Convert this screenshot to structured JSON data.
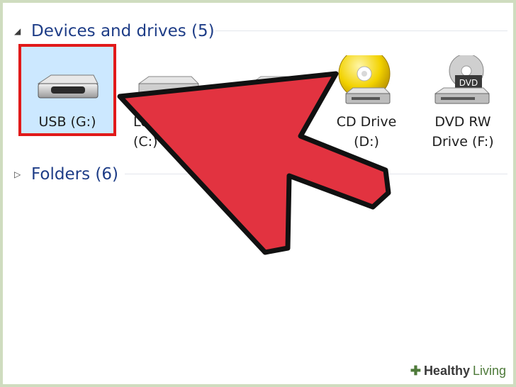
{
  "devices_section": {
    "title": "Devices and drives (5)",
    "expanded": true,
    "items": [
      {
        "label": "USB (G:)",
        "icon": "usb-drive-icon",
        "selected": true
      },
      {
        "label": "Local Disk\n(C:)",
        "icon": "hard-drive-icon",
        "selected": false
      },
      {
        "label": "",
        "icon": "hard-drive-icon",
        "selected": false
      },
      {
        "label": "CD Drive\n(D:)",
        "icon": "cd-drive-icon",
        "selected": false
      },
      {
        "label": "DVD RW\nDrive (F:)",
        "icon": "dvd-drive-icon",
        "selected": false
      }
    ]
  },
  "folders_section": {
    "title": "Folders (6)",
    "expanded": false
  },
  "dvd_badge": "DVD",
  "watermark": {
    "brand": "Healthy",
    "brand2": "Living"
  },
  "colors": {
    "highlight_border": "#e11a1a",
    "arrow_fill": "#e23340",
    "selection_bg": "#cce8ff",
    "heading": "#1e3d87"
  }
}
